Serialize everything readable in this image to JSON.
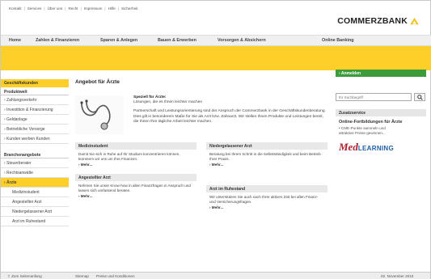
{
  "util_nav": [
    "Kontakt",
    "Services",
    "Über uns",
    "Recht",
    "Impressum",
    "Hilfe",
    "Sicherheit"
  ],
  "logo": {
    "text": "COMMERZBANK",
    "accent": "#fecf28"
  },
  "main_nav": [
    "Home",
    "Zahlen & Finanzieren",
    "Sparen & Anlegen",
    "Bauen & Erwerben",
    "Vorsorgen & Absichern",
    "Online Banking"
  ],
  "anmelden": "› Anmelden",
  "sidebar": {
    "header": "Geschäftskunden",
    "section1": "Produktwelt",
    "items1": [
      "› Zahlungsverkehr",
      "› Investition & Finanzierung",
      "› Geldanlage",
      "› Betriebliche Vorsorge",
      "› Kunden werben Kunden"
    ],
    "section2": "Branchenangebote",
    "items2": [
      "› Steuerberater",
      "› Rechtsanwälte",
      "› Ärzte"
    ],
    "children": [
      "Medizinstudent",
      "Angestellter Arzt",
      "Niedergelassener Arzt",
      "Arzt im Ruhestand"
    ]
  },
  "content": {
    "title": "Angebot für Ärzte",
    "intro_lead": "Speziell für Ärzte:",
    "intro_sub": "Lösungen, die es Ihnen leichter machen",
    "intro_body": "Partnerschaft und Leistungsorientierung sind der Anspruch der Commerzbank in der Geschäftskundenberatung. Dies gilt in besonderem Maße für Sie als Arzt bzw. Zahnarzt. Wir stellen Ihnen Produkte und Leistungen bereit, die Ihnen Ihre tägliche Arbeit leichter machen.",
    "boxes": [
      {
        "head": "Medizinstudent",
        "body": "Damit Sie sich in Ruhe auf Ihr Studium konzentrieren können, kümmern wir uns um Ihre Finanzen.",
        "more": "› Mehr..."
      },
      {
        "head": "Niedergelassener Arzt",
        "body": "Beratung bei Ihrem Schritt in die Selbstständigkeit und beim Betrieb Ihrer Praxis.",
        "more": "› Mehr..."
      },
      {
        "head": "Angestellter Arzt",
        "body": "Nehmen Sie unser Know-how in allen Finanzfragen in Anspruch und lassen sich umfassend beraten.",
        "more": "› Mehr..."
      },
      {
        "head": "Arzt im Ruhestand",
        "body": "Wir unterstützen Sie auch nach Ihrer aktiven Zeit bei allen Finanz- und Versicherungsfragen.",
        "more": "› Mehr..."
      }
    ]
  },
  "right": {
    "search_placeholder": "Ihr Suchbegriff",
    "zusatz": "Zusatzservice",
    "promo_title": "Online-Fortbildungen für Ärzte",
    "promo_lines": [
      "• CME-Punkte sammeln und",
      "attraktive Preise gewinnen..."
    ],
    "med_logo": {
      "part1": "Med",
      "part2": "LEARNING"
    }
  },
  "footer": {
    "back_to_top": "⇧ Zum Seitenanfang",
    "links": [
      "Sitemap",
      "Preise und Konditionen"
    ],
    "date": "02. November 2010"
  }
}
